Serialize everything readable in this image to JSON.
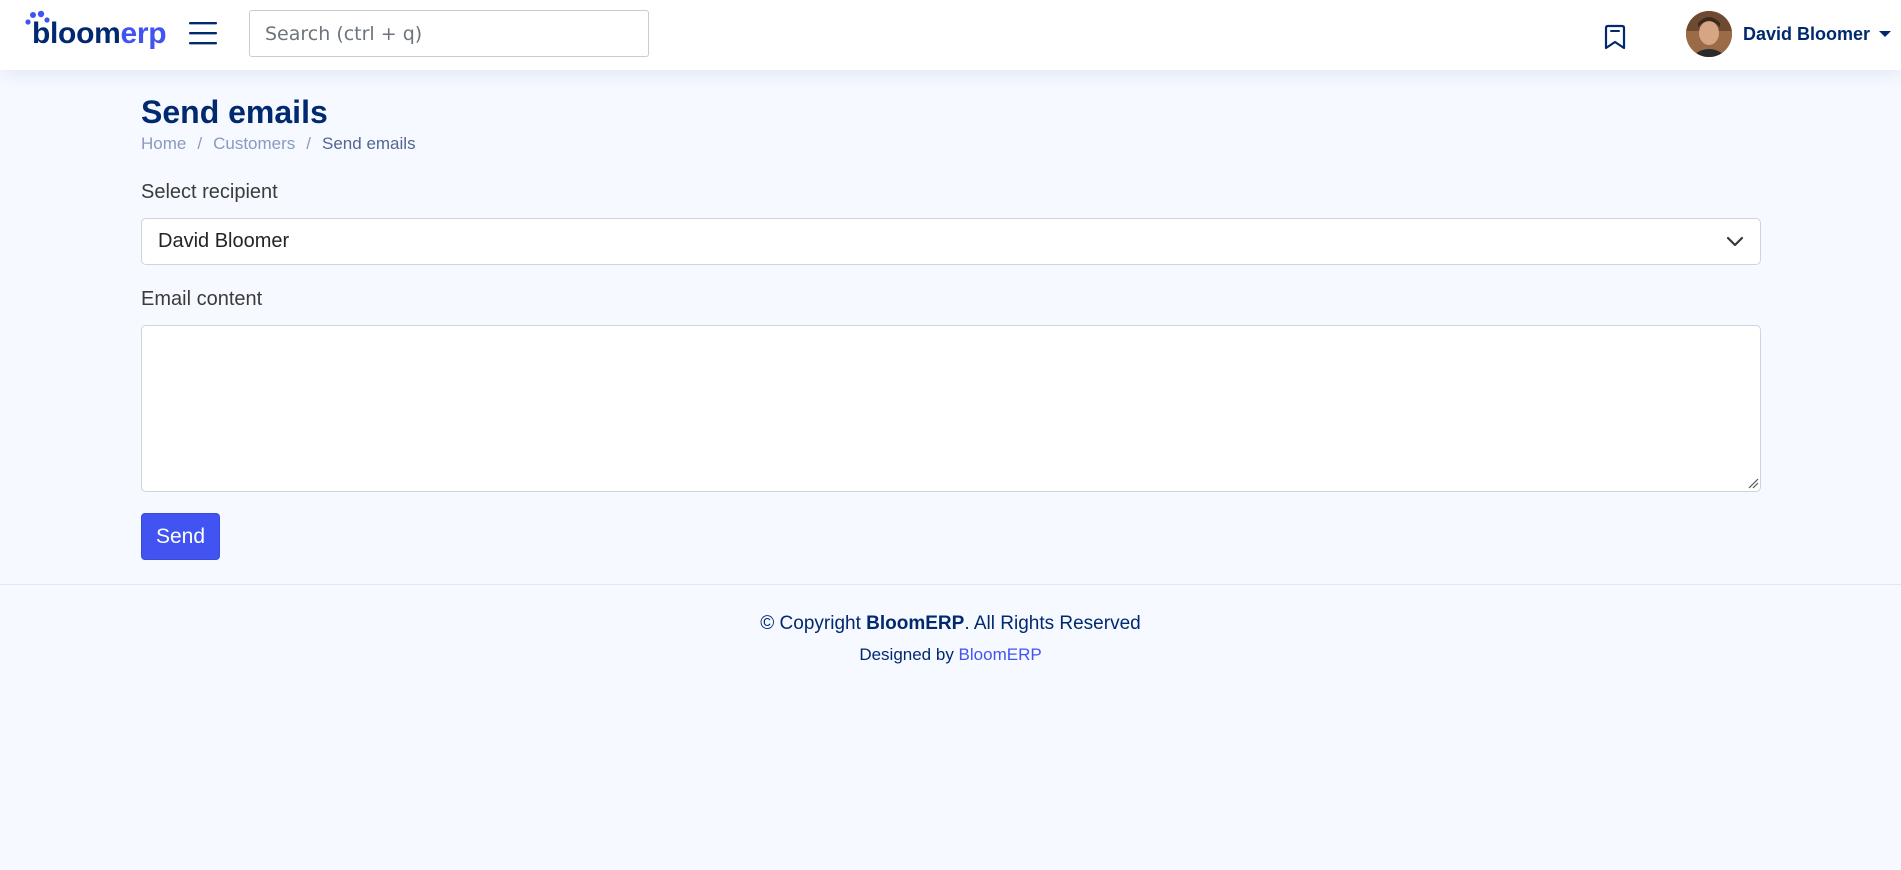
{
  "header": {
    "logo": {
      "text_main": "bloom",
      "text_accent": "erp"
    },
    "search": {
      "placeholder": "Search (ctrl + q)",
      "value": ""
    },
    "profile": {
      "name": "David Bloomer"
    },
    "icons": {
      "menu": "hamburger-menu-icon",
      "bookmark": "bookmark-icon",
      "caret": "caret-down-icon"
    }
  },
  "page": {
    "title": "Send emails",
    "breadcrumb": [
      {
        "label": "Home"
      },
      {
        "label": "Customers"
      },
      {
        "label": "Send emails"
      }
    ],
    "breadcrumb_separator": "/"
  },
  "form": {
    "recipient_label": "Select recipient",
    "recipient_value": "David Bloomer",
    "content_label": "Email content",
    "content_value": "",
    "send_label": "Send"
  },
  "footer": {
    "copyright_prefix": "© Copyright ",
    "copyright_brand": "BloomERP",
    "copyright_suffix": ". All Rights Reserved",
    "designed_by": "Designed by ",
    "designed_by_link": "BloomERP"
  },
  "colors": {
    "primary": "#4154f1",
    "navy": "#012970",
    "background": "#f6f9ff"
  }
}
